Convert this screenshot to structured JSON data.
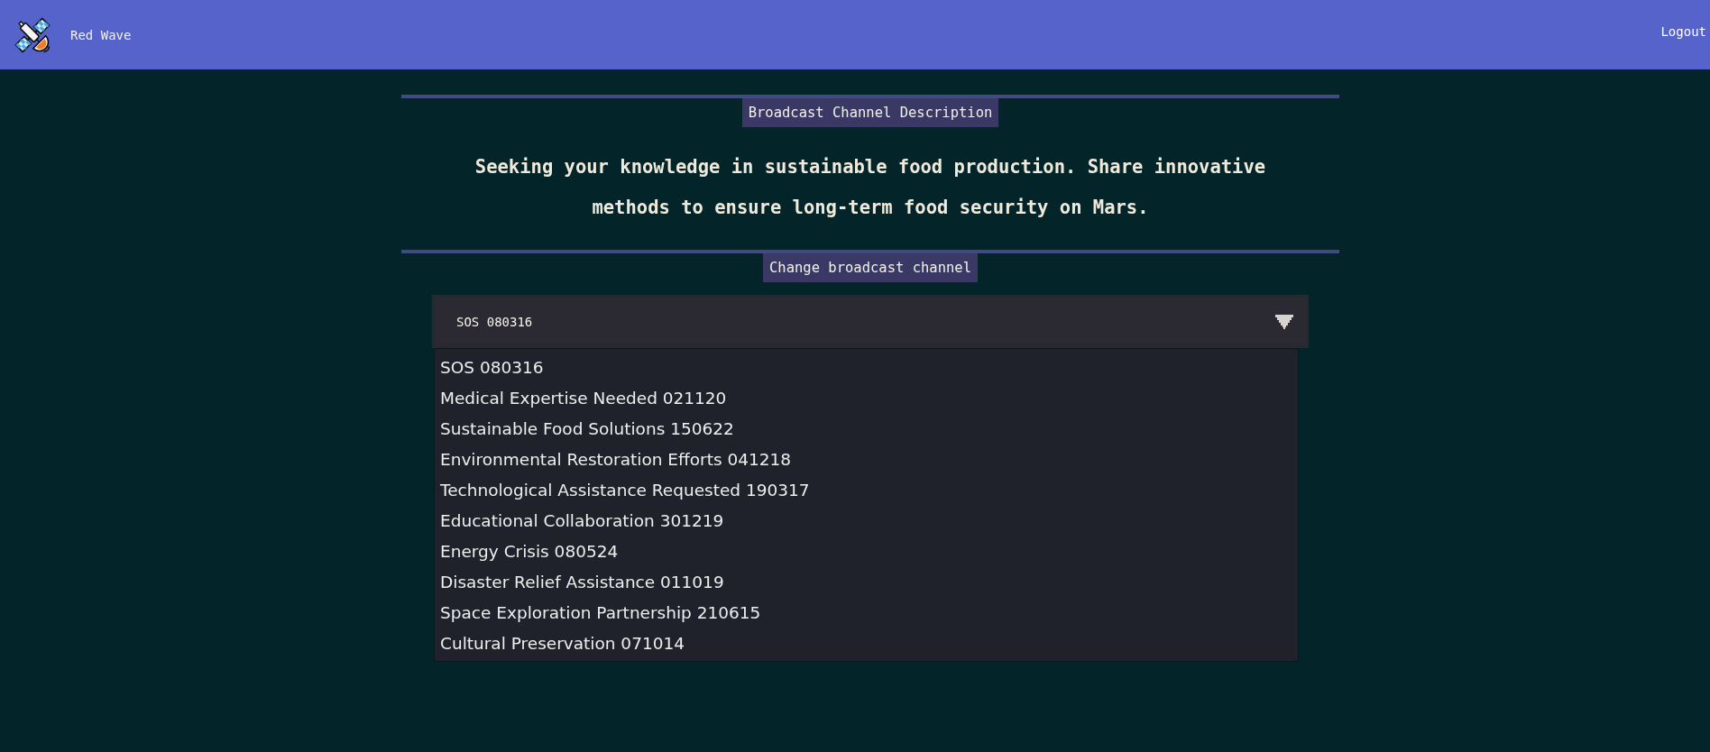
{
  "header": {
    "brand": "Red Wave",
    "logout": "Logout"
  },
  "description_section": {
    "label": "Broadcast Channel Description",
    "text": "Seeking your knowledge in sustainable food production. Share innovative methods to ensure long-term food security on Mars."
  },
  "channel_section": {
    "label": "Change broadcast channel",
    "select": {
      "value": "SOS 080316",
      "expanded": true
    },
    "options": [
      "SOS 080316",
      "Medical Expertise Needed 021120",
      "Sustainable Food Solutions 150622",
      "Environmental Restoration Efforts 041218",
      "Technological Assistance Requested 190317",
      "Educational Collaboration 301219",
      "Energy Crisis 080524",
      "Disaster Relief Assistance 011019",
      "Space Exploration Partnership 210615",
      "Cultural Preservation 071014"
    ]
  }
}
